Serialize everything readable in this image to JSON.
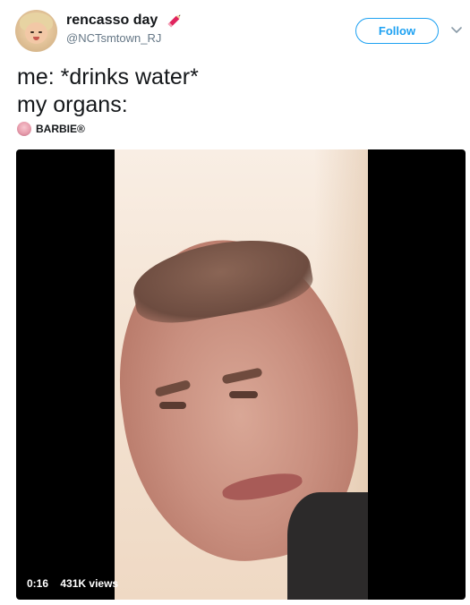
{
  "tweet": {
    "display_name": "rencasso day",
    "handle": "@NCTsmtown_RJ",
    "follow_label": "Follow",
    "text_line1": "me: *drinks water*",
    "text_line2": "my organs:",
    "attribution": "BARBIE®"
  },
  "video": {
    "duration": "0:16",
    "views": "431K views"
  },
  "colors": {
    "accent": "#1da1f2",
    "text": "#14171a",
    "secondary": "#657786",
    "pencil": "#e0245e"
  },
  "icons": {
    "name_emoji": "pencil-icon",
    "menu": "chevron-down-icon"
  }
}
